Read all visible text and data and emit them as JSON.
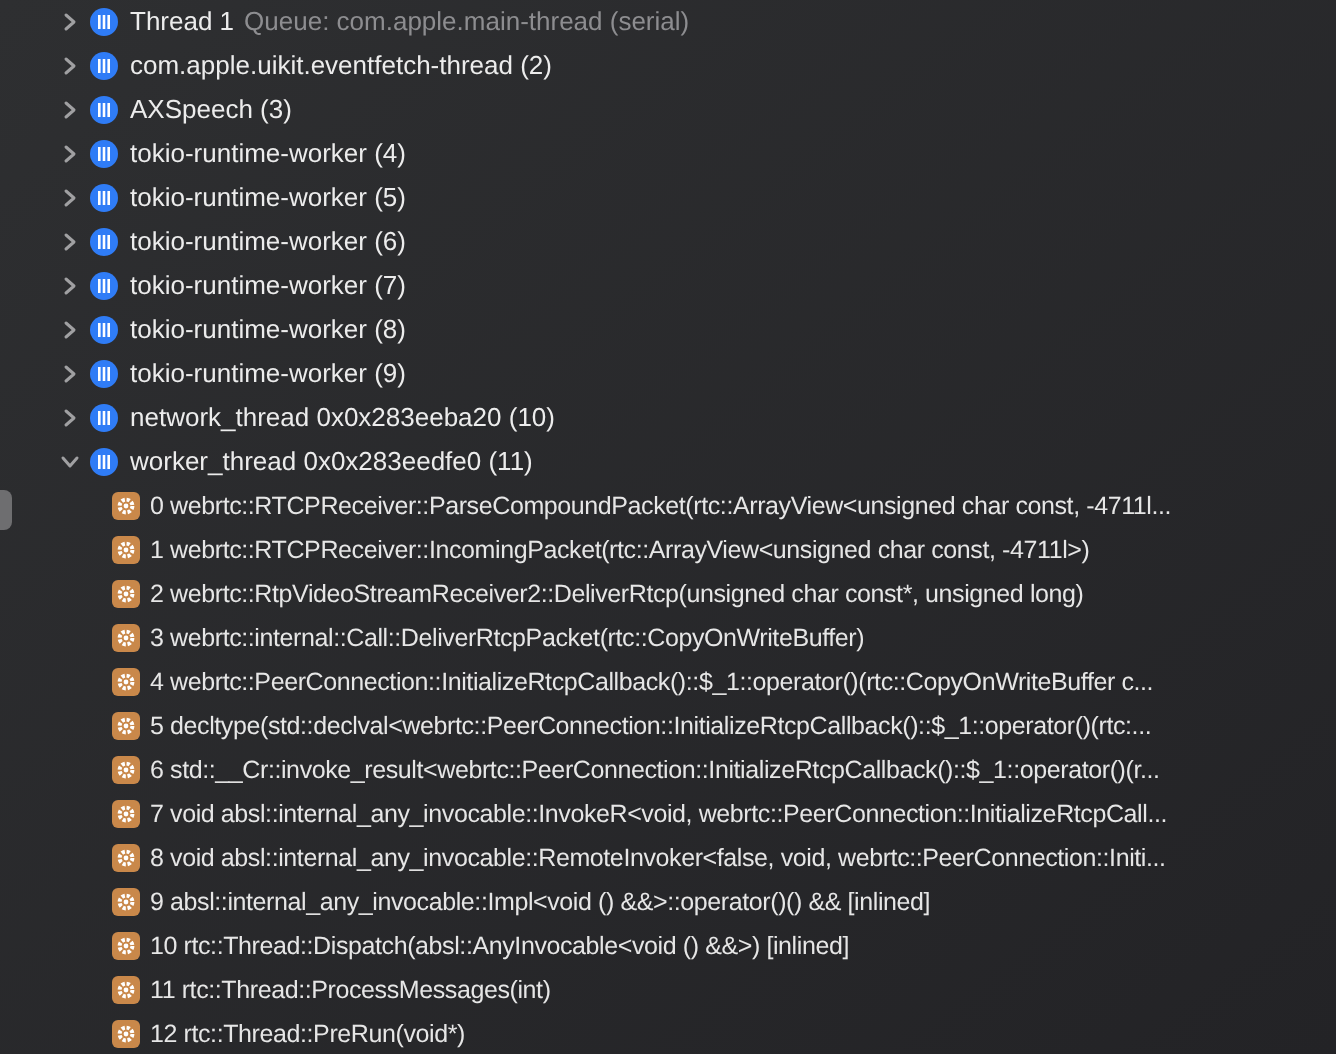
{
  "threads": [
    {
      "name": "Thread 1",
      "queue": "Queue: com.apple.main-thread (serial)",
      "expanded": false
    },
    {
      "name": "com.apple.uikit.eventfetch-thread (2)",
      "expanded": false
    },
    {
      "name": "AXSpeech (3)",
      "expanded": false
    },
    {
      "name": "tokio-runtime-worker (4)",
      "expanded": false
    },
    {
      "name": "tokio-runtime-worker (5)",
      "expanded": false
    },
    {
      "name": "tokio-runtime-worker (6)",
      "expanded": false
    },
    {
      "name": "tokio-runtime-worker (7)",
      "expanded": false
    },
    {
      "name": "tokio-runtime-worker (8)",
      "expanded": false
    },
    {
      "name": "tokio-runtime-worker (9)",
      "expanded": false
    },
    {
      "name": "network_thread 0x0x283eeba20 (10)",
      "expanded": false
    },
    {
      "name": "worker_thread 0x0x283eedfe0 (11)",
      "expanded": true,
      "children": [
        {
          "label": "0 webrtc::RTCPReceiver::ParseCompoundPacket(rtc::ArrayView<unsigned char const, -4711l..."
        },
        {
          "label": "1 webrtc::RTCPReceiver::IncomingPacket(rtc::ArrayView<unsigned char const, -4711l>)"
        },
        {
          "label": "2 webrtc::RtpVideoStreamReceiver2::DeliverRtcp(unsigned char const*, unsigned long)"
        },
        {
          "label": "3 webrtc::internal::Call::DeliverRtcpPacket(rtc::CopyOnWriteBuffer)"
        },
        {
          "label": "4 webrtc::PeerConnection::InitializeRtcpCallback()::$_1::operator()(rtc::CopyOnWriteBuffer c..."
        },
        {
          "label": "5 decltype(std::declval<webrtc::PeerConnection::InitializeRtcpCallback()::$_1::operator()(rtc:..."
        },
        {
          "label": "6 std::__Cr::invoke_result<webrtc::PeerConnection::InitializeRtcpCallback()::$_1::operator()(r..."
        },
        {
          "label": "7 void absl::internal_any_invocable::InvokeR<void, webrtc::PeerConnection::InitializeRtcpCall..."
        },
        {
          "label": "8 void absl::internal_any_invocable::RemoteInvoker<false, void, webrtc::PeerConnection::Initi..."
        },
        {
          "label": "9 absl::internal_any_invocable::Impl<void () &&>::operator()() && [inlined]"
        },
        {
          "label": "10 rtc::Thread::Dispatch(absl::AnyInvocable<void () &&>) [inlined]"
        },
        {
          "label": "11 rtc::Thread::ProcessMessages(int)"
        },
        {
          "label": "12 rtc::Thread::PreRun(void*)"
        }
      ]
    }
  ]
}
